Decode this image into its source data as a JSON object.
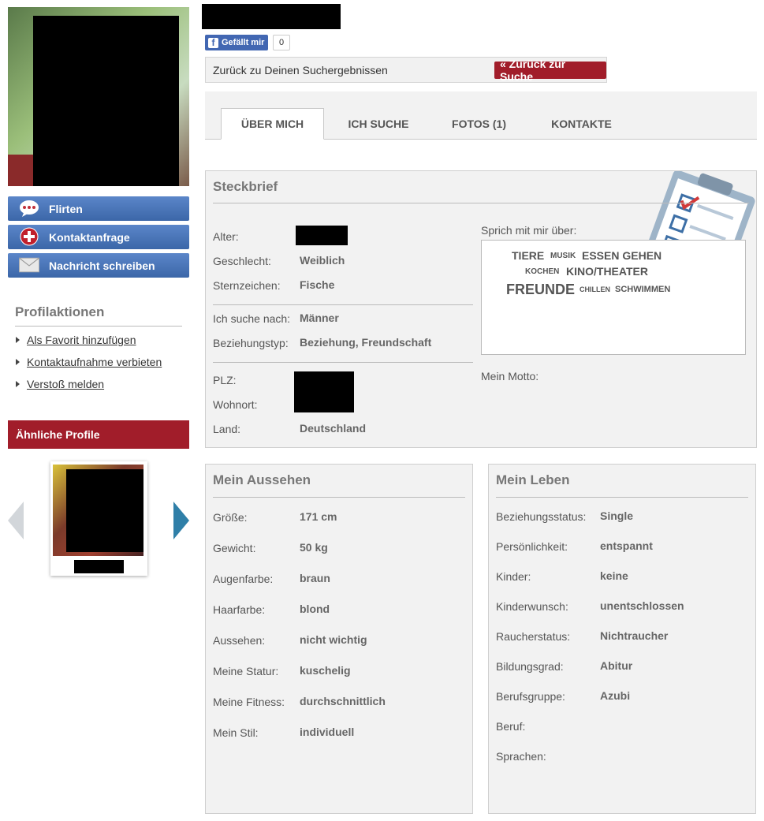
{
  "facebook": {
    "like_label": "Gefällt mir",
    "like_count": "0"
  },
  "back_bar": {
    "text": "Zurück zu Deinen Suchergebnissen",
    "button": "« Zurück zur Suche"
  },
  "tabs": [
    "ÜBER MICH",
    "ICH SUCHE",
    "FOTOS (1)",
    "KONTAKTE"
  ],
  "actions": [
    "Flirten",
    "Kontaktanfrage",
    "Nachricht schreiben"
  ],
  "profile_actions": {
    "title": "Profilaktionen",
    "links": [
      "Als Favorit hinzufügen",
      "Kontaktaufnahme verbieten",
      "Verstoß melden"
    ]
  },
  "similar_profiles": {
    "title": "Ähnliche Profile"
  },
  "steckbrief": {
    "title": "Steckbrief",
    "alter_label": "Alter:",
    "geschlecht_label": "Geschlecht:",
    "geschlecht": "Weiblich",
    "sternzeichen_label": "Sternzeichen:",
    "sternzeichen": "Fische",
    "sucht_label": "Ich suche nach:",
    "sucht": "Männer",
    "beziehungstyp_label": "Beziehungstyp:",
    "beziehungstyp": "Beziehung, Freundschaft",
    "plz_label": "PLZ:",
    "wohnort_label": "Wohnort:",
    "land_label": "Land:",
    "land": "Deutschland",
    "sprich_label": "Sprich mit mir über:",
    "motto_label": "Mein Motto:",
    "tags": [
      "TIERE",
      "MUSIK",
      "ESSEN GEHEN",
      "KOCHEN",
      "KINO/THEATER",
      "FREUNDE",
      "CHILLEN",
      "SCHWIMMEN"
    ]
  },
  "aussehen": {
    "title": "Mein Aussehen",
    "rows": [
      {
        "label": "Größe:",
        "value": "171 cm"
      },
      {
        "label": "Gewicht:",
        "value": "50 kg"
      },
      {
        "label": "Augenfarbe:",
        "value": "braun"
      },
      {
        "label": "Haarfarbe:",
        "value": "blond"
      },
      {
        "label": "Aussehen:",
        "value": "nicht wichtig"
      },
      {
        "label": "Meine Statur:",
        "value": "kuschelig"
      },
      {
        "label": "Meine Fitness:",
        "value": "durchschnittlich"
      },
      {
        "label": "Mein Stil:",
        "value": "individuell"
      }
    ]
  },
  "leben": {
    "title": "Mein Leben",
    "rows": [
      {
        "label": "Beziehungsstatus:",
        "value": "Single"
      },
      {
        "label": "Persönlichkeit:",
        "value": "entspannt"
      },
      {
        "label": "Kinder:",
        "value": "keine"
      },
      {
        "label": "Kinderwunsch:",
        "value": "unentschlossen"
      },
      {
        "label": "Raucherstatus:",
        "value": "Nichtraucher"
      },
      {
        "label": "Bildungsgrad:",
        "value": "Abitur"
      },
      {
        "label": "Berufsgruppe:",
        "value": "Azubi"
      },
      {
        "label": "Beruf:",
        "value": ""
      },
      {
        "label": "Sprachen:",
        "value": ""
      }
    ]
  },
  "colors": {
    "accent_red": "#a11d2a",
    "button_blue": "#3c67a8",
    "facebook_blue": "#4267b2"
  }
}
